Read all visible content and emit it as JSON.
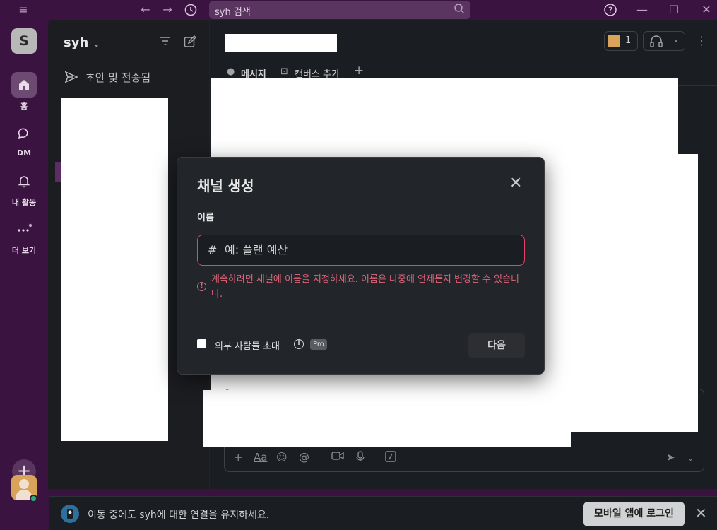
{
  "titlebar": {
    "search_text": "syh 검색",
    "icons": [
      "menu-icon",
      "back-arrow-icon",
      "forward-arrow-icon",
      "history-icon",
      "search-icon",
      "help-icon",
      "minimize-icon",
      "maximize-icon",
      "close-icon"
    ]
  },
  "rail": {
    "workspace_initial": "S",
    "items": [
      {
        "label": "홈",
        "icon": "home-icon"
      },
      {
        "label": "DM",
        "icon": "dm-icon"
      },
      {
        "label": "내 활동",
        "icon": "bell-icon"
      },
      {
        "label": "더 보기",
        "icon": "more-icon"
      }
    ]
  },
  "sidebar": {
    "workspace_name": "syh",
    "drafts_label": "초안 및 전송됨"
  },
  "main": {
    "huddle_count": "1",
    "tabs": [
      {
        "label": "메시지"
      },
      {
        "label": "캔버스 추가"
      }
    ]
  },
  "modal": {
    "title": "채널 생성",
    "name_label": "이름",
    "name_placeholder": "예: 플랜 예산",
    "hash": "#",
    "error_text": "계속하려면 채널에 이름을 지정하세요. 이름은 나중에 언제든지 변경할 수 있습니다.",
    "invite_label": "외부 사람들 초대",
    "pro_badge": "Pro",
    "next_button": "다음"
  },
  "banner": {
    "text": "이동 중에도 syh에 대한 연결을 유지하세요.",
    "button": "모바일 앱에 로그인"
  },
  "colors": {
    "error": "#e06479",
    "aubergine": "#3b1340",
    "dark_bg": "#1a1d21"
  }
}
